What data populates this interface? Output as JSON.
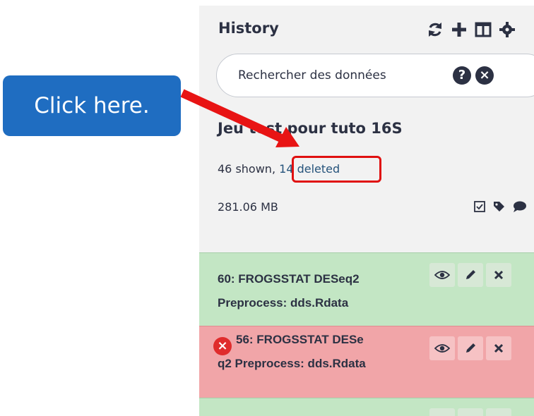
{
  "annotation": {
    "callout_text": "Click here.",
    "arrow_color": "#e81414",
    "callout_color": "#1f6dc1"
  },
  "panel": {
    "title": "History",
    "header_icons": [
      "refresh-icon",
      "plus-icon",
      "columns-icon",
      "gear-icon"
    ],
    "search": {
      "placeholder": "Rechercher des données",
      "help_label": "?",
      "clear_label": "×"
    },
    "history_name": "Jeu test pour tuto 16S",
    "counts": {
      "shown": "46 shown,",
      "deleted": "14 deleted"
    },
    "size": "281.06 MB",
    "tag_icons": [
      "checkbox-icon",
      "tags-icon",
      "comment-icon"
    ],
    "datasets": [
      {
        "title_line1": "60: FROGSSTAT DESeq2",
        "title_line2": "Preprocess: dds.Rdata",
        "state": "ok",
        "state_color": "#c3e6c4"
      },
      {
        "title_line1": "56: FROGSSTAT DESe",
        "title_line2": "q2 Preprocess: dds.Rdata",
        "state": "error",
        "state_color": "#f1a5a8",
        "error_badge": "×"
      },
      {
        "title_line1": "",
        "title_line2": "",
        "state": "ok",
        "state_color": "#c3e6c4"
      }
    ]
  }
}
